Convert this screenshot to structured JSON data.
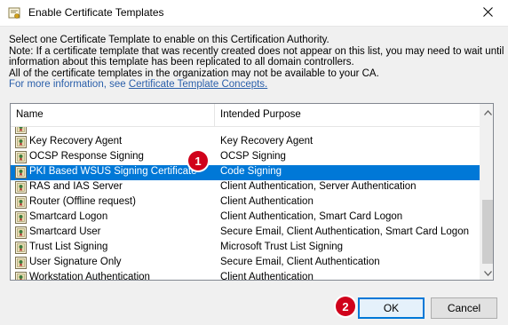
{
  "window": {
    "title": "Enable Certificate Templates"
  },
  "description": {
    "line1": "Select one Certificate Template to enable on this Certification Authority.",
    "line2": "Note: If a certificate template that was recently created does not appear on this list, you may need to wait until",
    "line3": "information about this template has been replicated to all domain controllers.",
    "line4": "All of the certificate templates in the organization may not be available to your CA.",
    "info_prefix": "For more information, see ",
    "info_link": "Certificate Template Concepts.",
    "link_color": "#2a5faa"
  },
  "list": {
    "columns": {
      "name": "Name",
      "purpose": "Intended Purpose"
    },
    "rows": [
      {
        "name": "",
        "purpose": ""
      },
      {
        "name": "Key Recovery Agent",
        "purpose": "Key Recovery Agent"
      },
      {
        "name": "OCSP Response Signing",
        "purpose": "OCSP Signing"
      },
      {
        "name": "PKI Based WSUS Signing Certificate",
        "purpose": "Code Signing",
        "selected": true
      },
      {
        "name": "RAS and IAS Server",
        "purpose": "Client Authentication, Server Authentication"
      },
      {
        "name": "Router (Offline request)",
        "purpose": "Client Authentication"
      },
      {
        "name": "Smartcard Logon",
        "purpose": "Client Authentication, Smart Card Logon"
      },
      {
        "name": "Smartcard User",
        "purpose": "Secure Email, Client Authentication, Smart Card Logon"
      },
      {
        "name": "Trust List Signing",
        "purpose": "Microsoft Trust List Signing"
      },
      {
        "name": "User Signature Only",
        "purpose": "Secure Email, Client Authentication"
      },
      {
        "name": "Workstation Authentication",
        "purpose": "Client Authentication"
      }
    ],
    "row_icon": "certificate-template-icon",
    "selection_color": "#0078d7"
  },
  "buttons": {
    "ok": "OK",
    "cancel": "Cancel"
  },
  "annotations": {
    "step1": "1",
    "step2": "2",
    "color": "#d0021b"
  }
}
